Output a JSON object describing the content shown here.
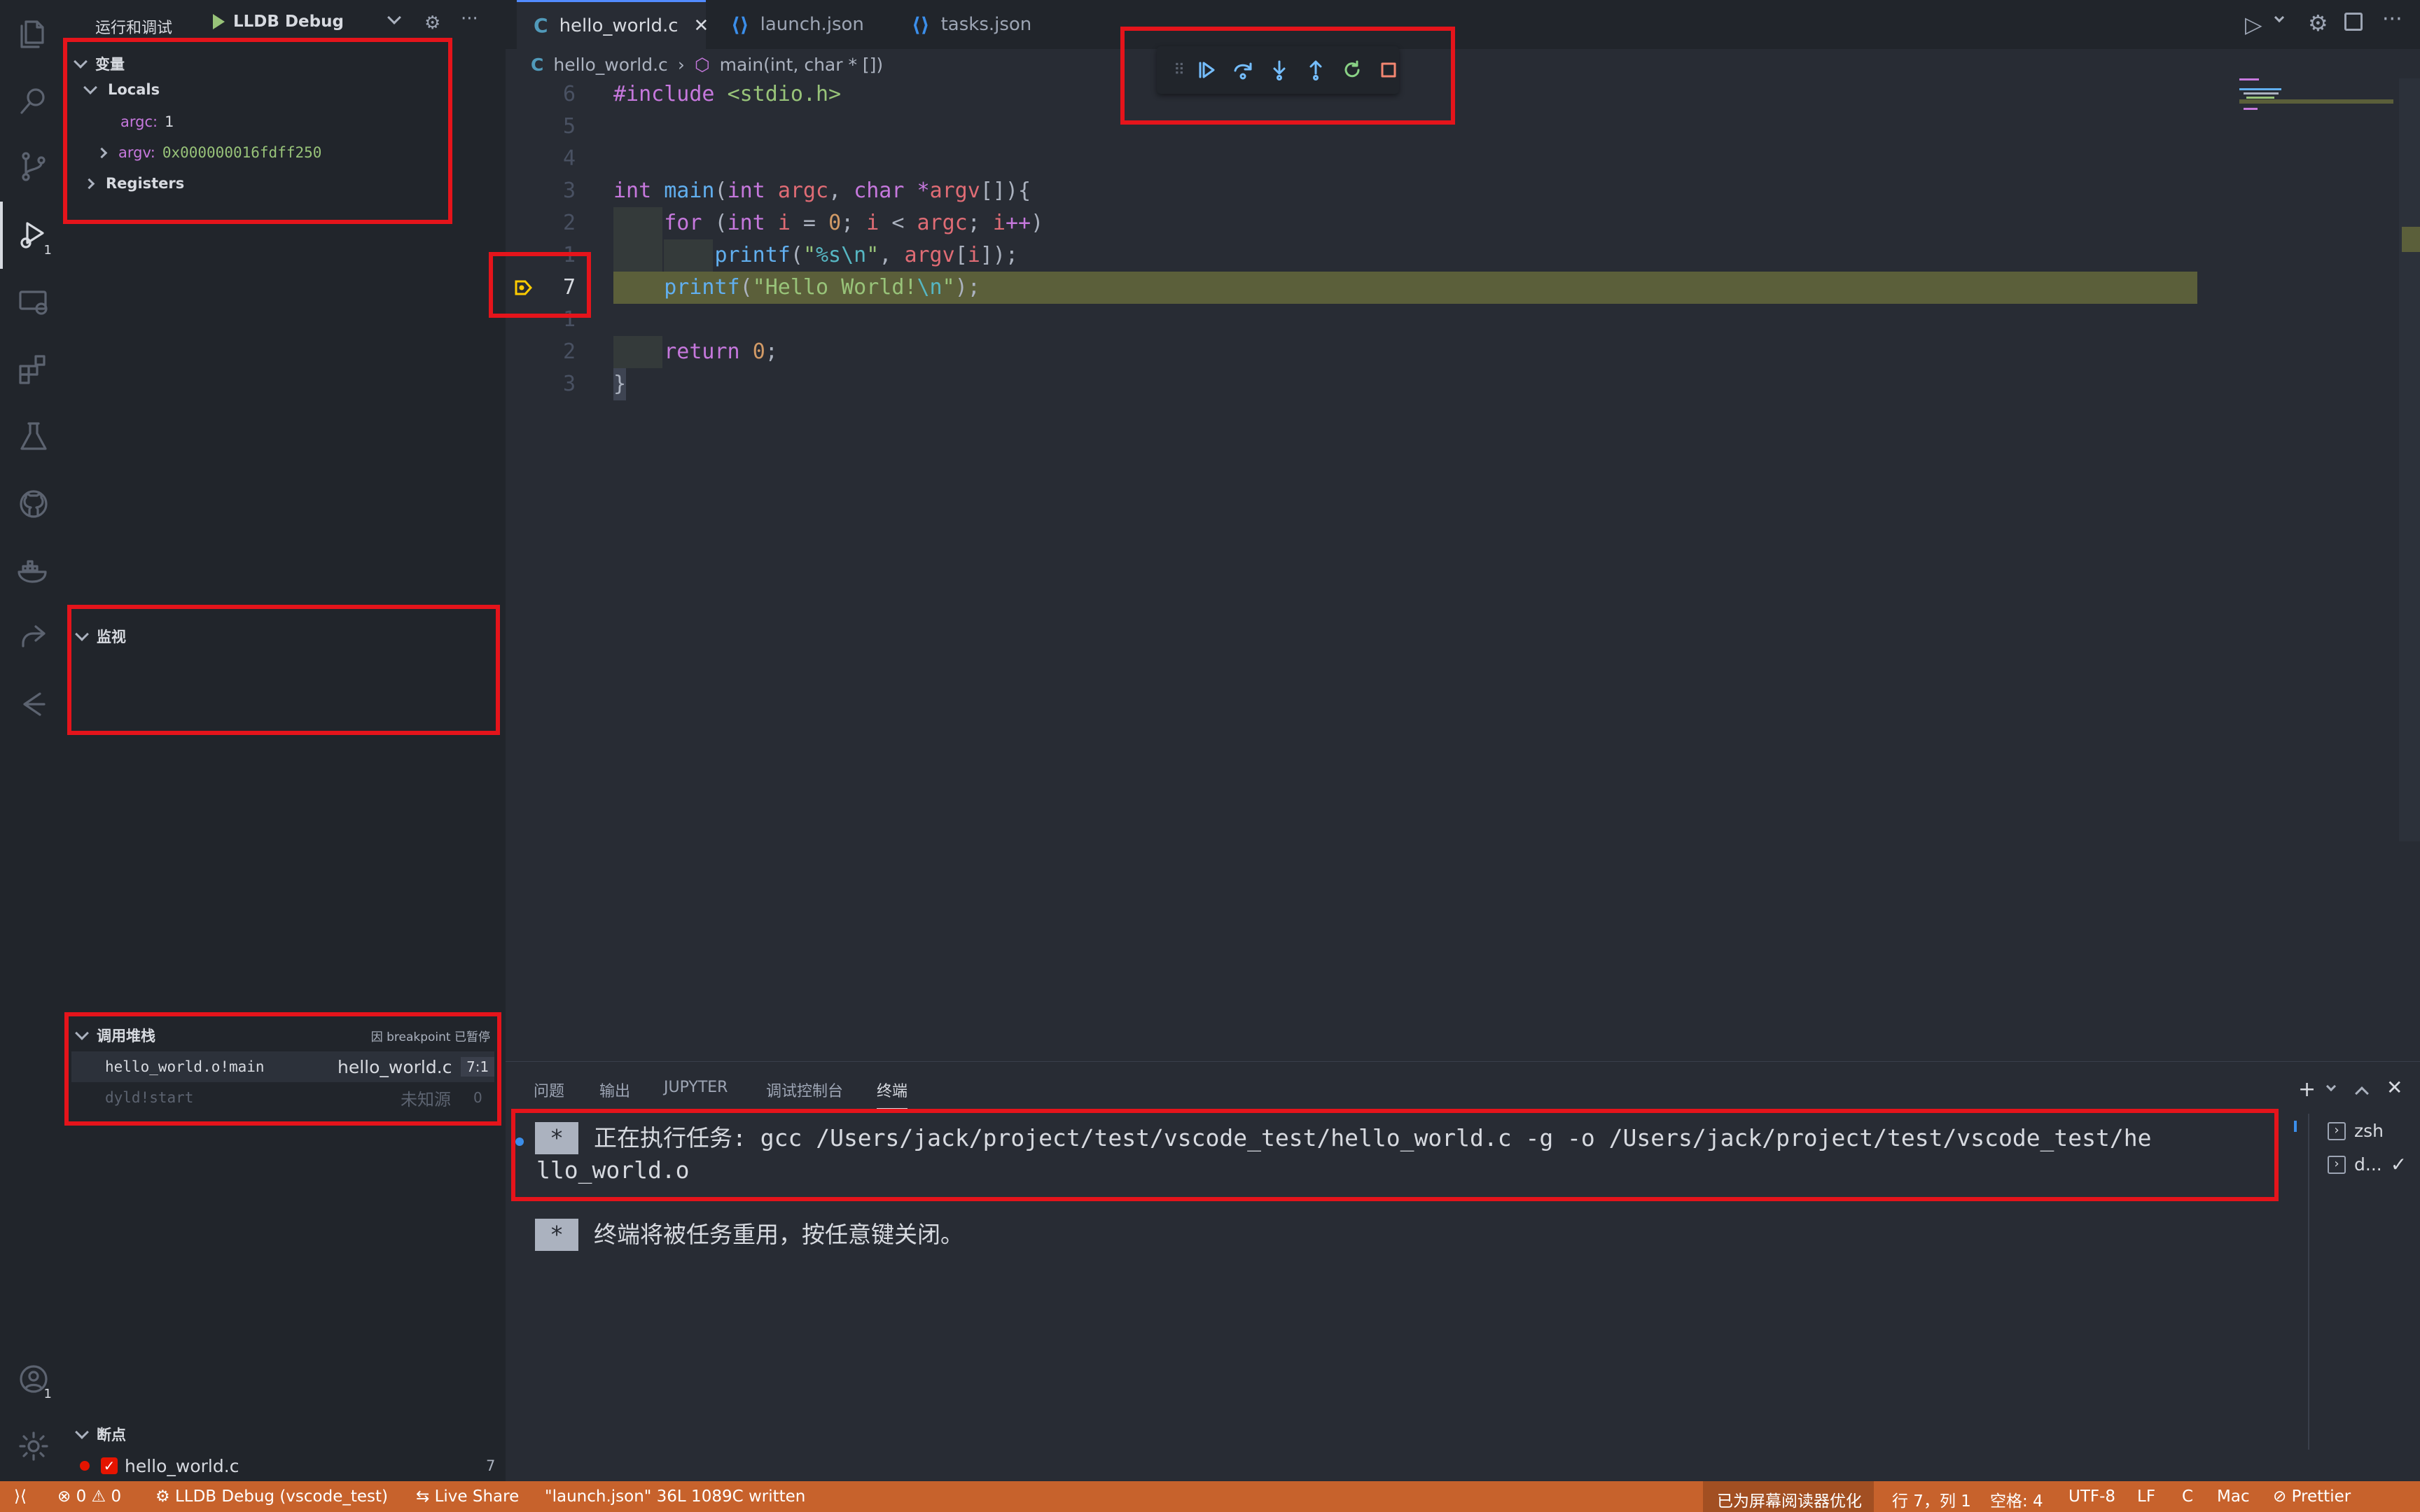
{
  "activity_bar": {
    "debug_badge": "1",
    "account_badge": "1"
  },
  "sidebar": {
    "title": "运行和调试",
    "debug_config": "LLDB Debug",
    "variables": {
      "header": "变量",
      "locals_label": "Locals",
      "items": [
        {
          "name": "argc:",
          "value": "1"
        },
        {
          "name": "argv:",
          "value": "0x000000016fdff250"
        }
      ],
      "registers_label": "Registers"
    },
    "watch": {
      "header": "监视"
    },
    "call_stack": {
      "header": "调用堆栈",
      "status": "因 breakpoint 已暂停",
      "frames": [
        {
          "name": "hello_world.o!main",
          "file": "hello_world.c",
          "pos": "7:1"
        },
        {
          "name": "dyld!start",
          "file": "未知源",
          "pos": "0"
        }
      ]
    },
    "breakpoints": {
      "header": "断点",
      "items": [
        {
          "file": "hello_world.c",
          "line": "7"
        }
      ]
    }
  },
  "editor": {
    "tabs": [
      {
        "label": "hello_world.c",
        "icon": "C",
        "active": true
      },
      {
        "label": "launch.json",
        "icon": "vscode",
        "active": false
      },
      {
        "label": "tasks.json",
        "icon": "vscode",
        "active": false
      }
    ],
    "breadcrumb": {
      "file": "hello_world.c",
      "symbol": "main(int, char * [])"
    },
    "line_numbers": [
      "6",
      "5",
      "4",
      "3",
      "2",
      "1",
      "7",
      "1",
      "2",
      "3"
    ],
    "code_lines": [
      "#include <stdio.h>",
      "",
      "",
      "int main(int argc, char *argv[]){",
      "    for (int i = 0; i < argc; i++)",
      "        printf(\"%s\\n\", argv[i]);",
      "    printf(\"Hello World!\\n\");",
      "",
      "    return 0;",
      "}"
    ],
    "current_line": "7"
  },
  "panel": {
    "tabs": [
      "问题",
      "输出",
      "JUPYTER",
      "调试控制台",
      "终端"
    ],
    "active_tab": "终端",
    "terminal": {
      "star": "*",
      "line1": "正在执行任务: gcc /Users/jack/project/test/vscode_test/hello_world.c -g -o /Users/jack/project/test/vscode_test/he",
      "line1_cont": "llo_world.o",
      "line2": "终端将被任务重用，按任意键关闭。"
    },
    "terminals": [
      {
        "label": "zsh"
      },
      {
        "label": "d...",
        "check": "✓"
      }
    ]
  },
  "status_bar": {
    "problems": "⊗ 0 ⚠ 0",
    "debug": "LLDB Debug (vscode_test)",
    "live_share": "Live Share",
    "message": "\"launch.json\" 36L 1089C written",
    "screen_reader": "已为屏幕阅读器优化",
    "position": "行 7，列 1",
    "spaces": "空格: 4",
    "encoding": "UTF-8",
    "eol": "LF",
    "language": "C",
    "platform": "Mac",
    "prettier": "Prettier"
  },
  "colors": {
    "status_bar": "#c7622c",
    "annotation": "#e5141b",
    "current_line": "#5b5f3a"
  }
}
